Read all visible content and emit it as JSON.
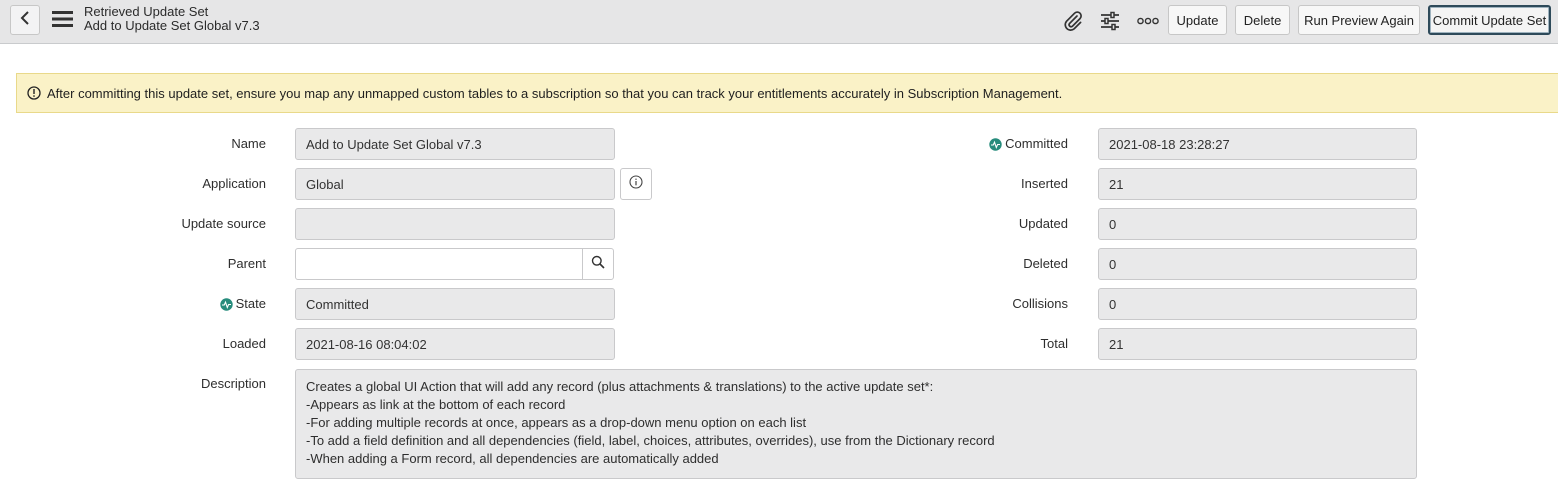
{
  "header": {
    "subtitle": "Retrieved Update Set",
    "title": "Add to Update Set Global v7.3",
    "buttons": {
      "update": "Update",
      "delete": "Delete",
      "run_preview": "Run Preview Again",
      "commit": "Commit Update Set"
    },
    "icons": [
      "back-arrow-icon",
      "hamburger-menu-icon",
      "paperclip-icon",
      "settings-sliders-icon",
      "more-options-icon"
    ]
  },
  "banner": {
    "text": "After committing this update set, ensure you map any unmapped custom tables to a subscription so that you can track your entitlements accurately in Subscription Management."
  },
  "form": {
    "left": {
      "name": {
        "label": "Name",
        "value": "Add to Update Set Global v7.3"
      },
      "application": {
        "label": "Application",
        "value": "Global"
      },
      "update_source": {
        "label": "Update source",
        "value": ""
      },
      "parent": {
        "label": "Parent",
        "value": ""
      },
      "state": {
        "label": "State",
        "value": "Committed"
      },
      "loaded": {
        "label": "Loaded",
        "value": "2021-08-16 08:04:02"
      }
    },
    "right": {
      "committed": {
        "label": "Committed",
        "value": "2021-08-18 23:28:27"
      },
      "inserted": {
        "label": "Inserted",
        "value": "21"
      },
      "updated": {
        "label": "Updated",
        "value": "0"
      },
      "deleted": {
        "label": "Deleted",
        "value": "0"
      },
      "collisions": {
        "label": "Collisions",
        "value": "0"
      },
      "total": {
        "label": "Total",
        "value": "21"
      }
    },
    "description": {
      "label": "Description",
      "lines": [
        "Creates a global UI Action that will add any record (plus attachments & translations) to the active update set*:",
        "-Appears as link at the bottom of each record",
        "-For adding multiple records at once, appears as a drop-down menu option on each list",
        "-To add a field definition and all dependencies (field, label, choices, attributes, overrides), use from the Dictionary record",
        "-When adding a Form record, all dependencies are automatically added"
      ]
    }
  },
  "colors": {
    "header_bg": "#e6e6e7",
    "banner_bg": "#faf2c7",
    "field_bg": "#e9e9ea",
    "verified_icon": "#278c7c",
    "primary_border": "#2e4a5a"
  }
}
